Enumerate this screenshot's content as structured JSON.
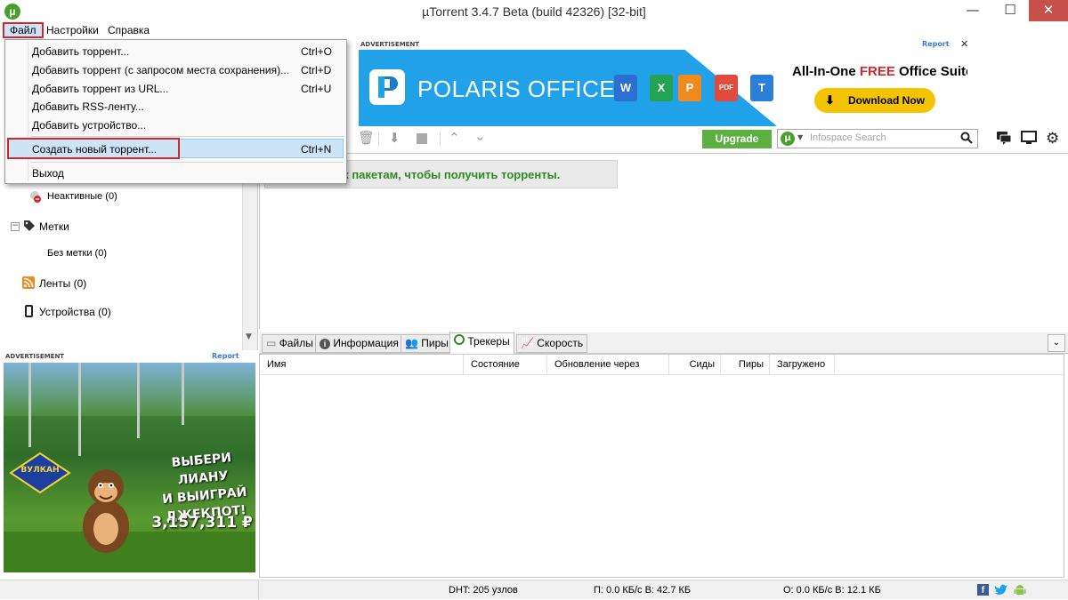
{
  "window": {
    "title": "µTorrent 3.4.7 Beta (build 42326) [32-bit]",
    "minimize": "—",
    "maximize": "☐",
    "close": "✕"
  },
  "menubar": {
    "file": "Файл",
    "settings": "Настройки",
    "help": "Справка"
  },
  "file_menu": {
    "items": [
      {
        "label": "Добавить торрент...",
        "shortcut": "Ctrl+O"
      },
      {
        "label": "Добавить торрент (с запросом места сохранения)...",
        "shortcut": "Ctrl+D"
      },
      {
        "label": "Добавить торрент из URL...",
        "shortcut": "Ctrl+U"
      },
      {
        "label": "Добавить RSS-ленту...",
        "shortcut": ""
      },
      {
        "label": "Добавить устройство...",
        "shortcut": ""
      },
      {
        "label": "Создать новый торрент...",
        "shortcut": "Ctrl+N"
      },
      {
        "label": "Выход",
        "shortcut": ""
      }
    ]
  },
  "sidebar": {
    "inactive": "Неактивные (0)",
    "labels": "Метки",
    "no_label": "Без метки (0)",
    "feeds": "Ленты (0)",
    "devices": "Устройства (0)"
  },
  "ads": {
    "label": "ADVERTISEMENT",
    "report": "Report",
    "close": "✕",
    "polaris_brand": "POLARIS OFFICE",
    "polaris_tagline_pre": "All-In-One ",
    "polaris_tagline_free": "FREE",
    "polaris_tagline_post": " Office Suite!",
    "polaris_download": "Download Now",
    "polaris_apps": [
      "W",
      "X",
      "P",
      "PDF",
      "T"
    ],
    "casino_brand": "ВУЛКАН",
    "casino_line1": "ВЫБЕРИ ЛИАНУ",
    "casino_line2": "И ВЫИГРАЙ",
    "casino_line3": "ДЖЕКПОТ!",
    "casino_amount": "3,157,311 ₽"
  },
  "toolbar": {
    "upgrade": "Upgrade",
    "search_placeholder": "Infospace Search"
  },
  "main": {
    "promo_text": "те к пакетам, чтобы получить торренты."
  },
  "tabs": {
    "items": [
      "Файлы",
      "Информация",
      "Пиры",
      "Трекеры",
      "Скорость"
    ],
    "active": "Трекеры"
  },
  "tracker_table": {
    "columns": [
      "Имя",
      "Состояние",
      "Обновление через",
      "Сиды",
      "Пиры",
      "Загружено"
    ]
  },
  "statusbar": {
    "dht": "DHT: 205 узлов",
    "download": "П: 0.0 КБ/с В: 42.7 КБ",
    "upload": "О: 0.0 КБ/с В: 12.1 КБ"
  },
  "colors": {
    "accent_green": "#5cb041",
    "highlight_red": "#d4262b",
    "polaris_blue": "#21a1e8",
    "close_red": "#c7504b"
  }
}
